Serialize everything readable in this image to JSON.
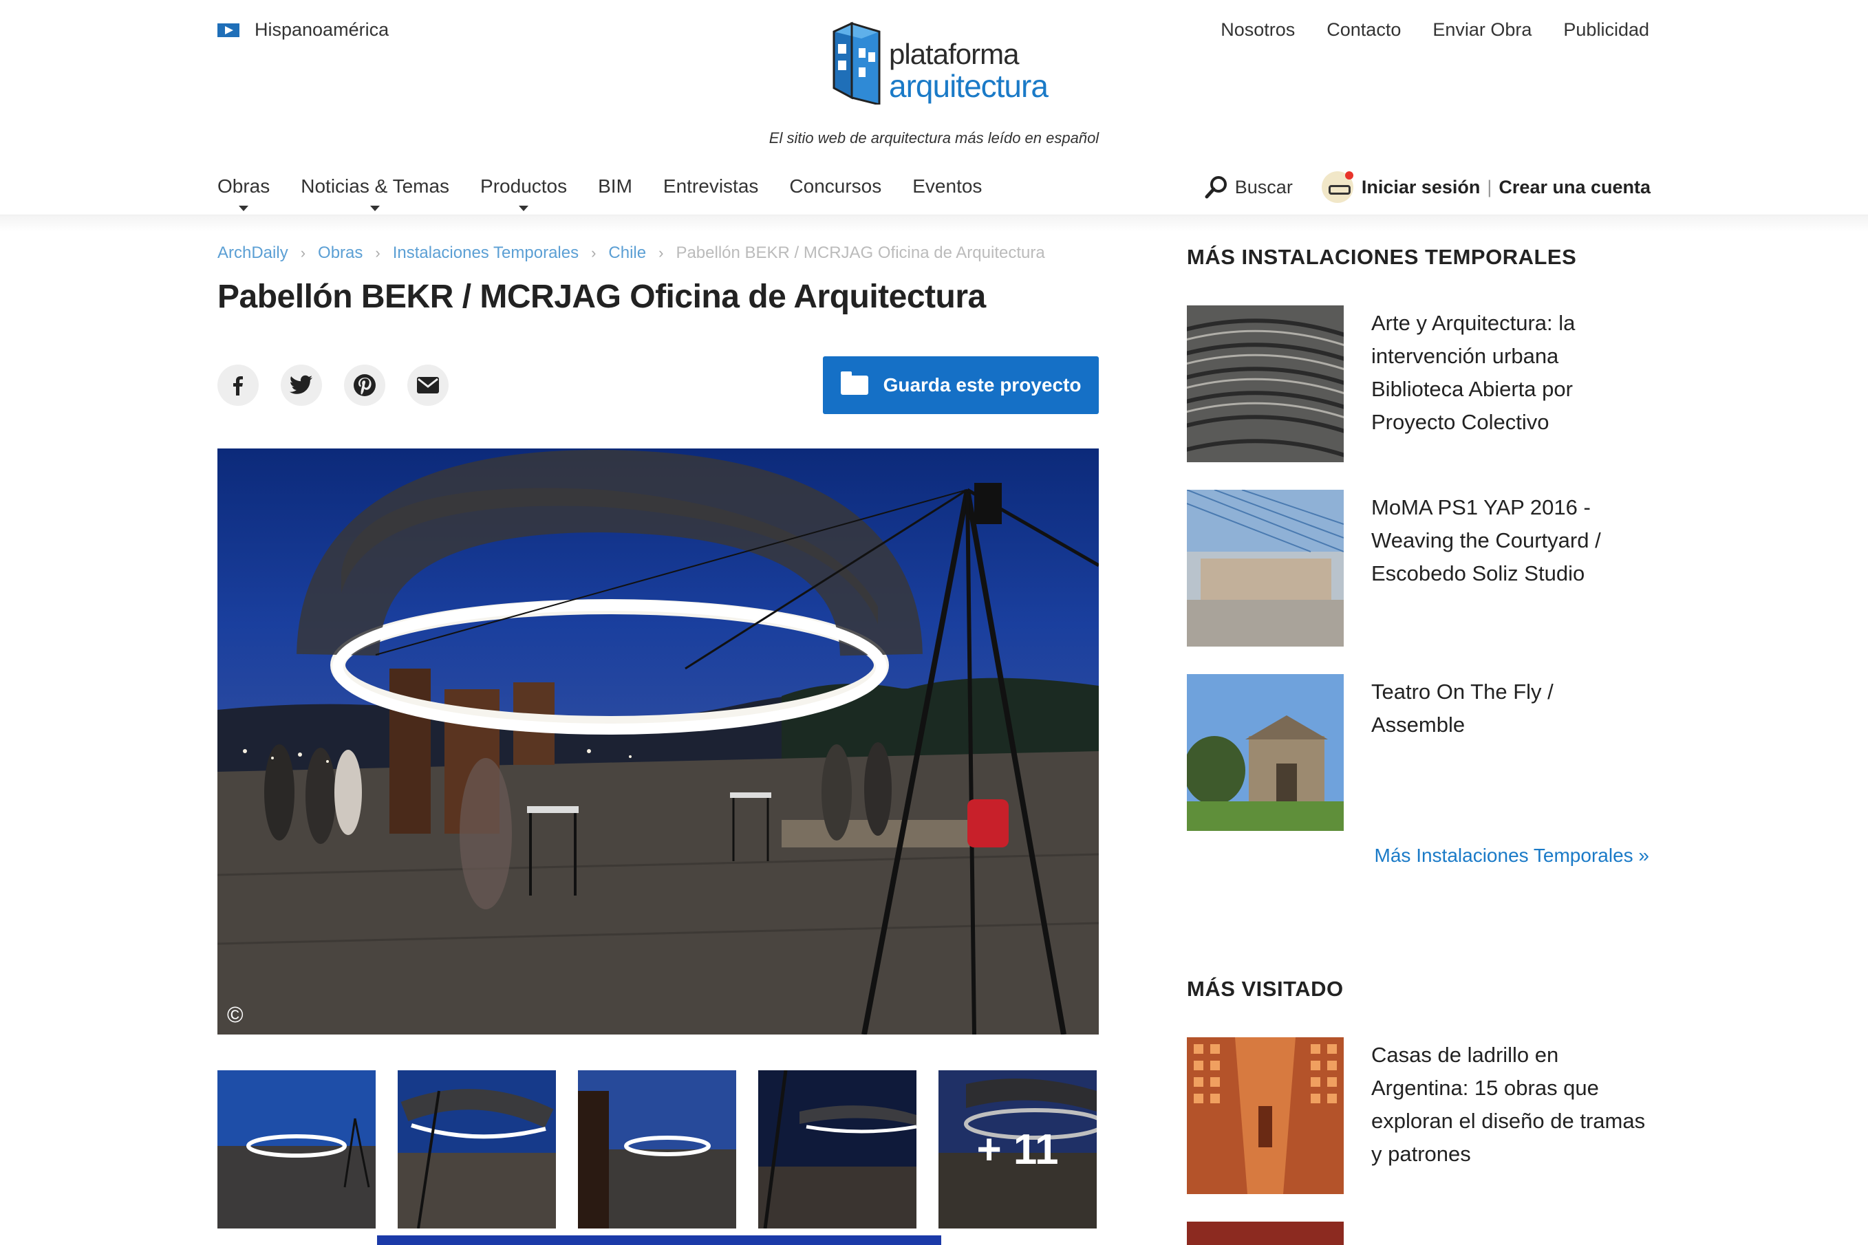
{
  "header": {
    "region": "Hispanoamérica",
    "logo_line1": "plataforma",
    "logo_line2": "arquitectura",
    "tagline": "El sitio web de arquitectura más leído en español",
    "links": [
      "Nosotros",
      "Contacto",
      "Enviar Obra",
      "Publicidad"
    ]
  },
  "nav": {
    "items": [
      {
        "label": "Obras",
        "dropdown": true
      },
      {
        "label": "Noticias & Temas",
        "dropdown": true
      },
      {
        "label": "Productos",
        "dropdown": true
      },
      {
        "label": "BIM",
        "dropdown": false
      },
      {
        "label": "Entrevistas",
        "dropdown": false
      },
      {
        "label": "Concursos",
        "dropdown": false
      },
      {
        "label": "Eventos",
        "dropdown": false
      }
    ],
    "search_label": "Buscar",
    "login_label": "Iniciar sesión",
    "separator": "|",
    "signup_label": "Crear una cuenta"
  },
  "breadcrumb": {
    "items": [
      "ArchDaily",
      "Obras",
      "Instalaciones Temporales",
      "Chile"
    ],
    "current": "Pabellón BEKR / MCRJAG Oficina de Arquitectura",
    "separator": "›"
  },
  "article": {
    "title": "Pabellón BEKR / MCRJAG Oficina de Arquitectura",
    "save_label": "Guarda este proyecto",
    "copyright_symbol": "©",
    "more_photos": "+ 11"
  },
  "share": [
    "facebook-icon",
    "twitter-icon",
    "pinterest-icon",
    "email-icon"
  ],
  "sidebar": {
    "section1_title": "MÁS INSTALACIONES TEMPORALES",
    "section1_items": [
      "Arte y Arquitectura: la intervención urbana Biblioteca Abierta por Proyecto Colectivo",
      "MoMA PS1 YAP 2016 - Weaving the Courtyard / Escobedo Soliz Studio",
      "Teatro On The Fly / Assemble"
    ],
    "more_link": "Más Instalaciones Temporales »",
    "section2_title": "MÁS VISITADO",
    "section2_items": [
      "Casas de ladrillo en Argentina: 15 obras que exploran el diseño de tramas y patrones"
    ]
  },
  "colors": {
    "accent": "#1570c6",
    "link": "#1a7ac7",
    "breadcrumb": "#5b9fd4"
  }
}
